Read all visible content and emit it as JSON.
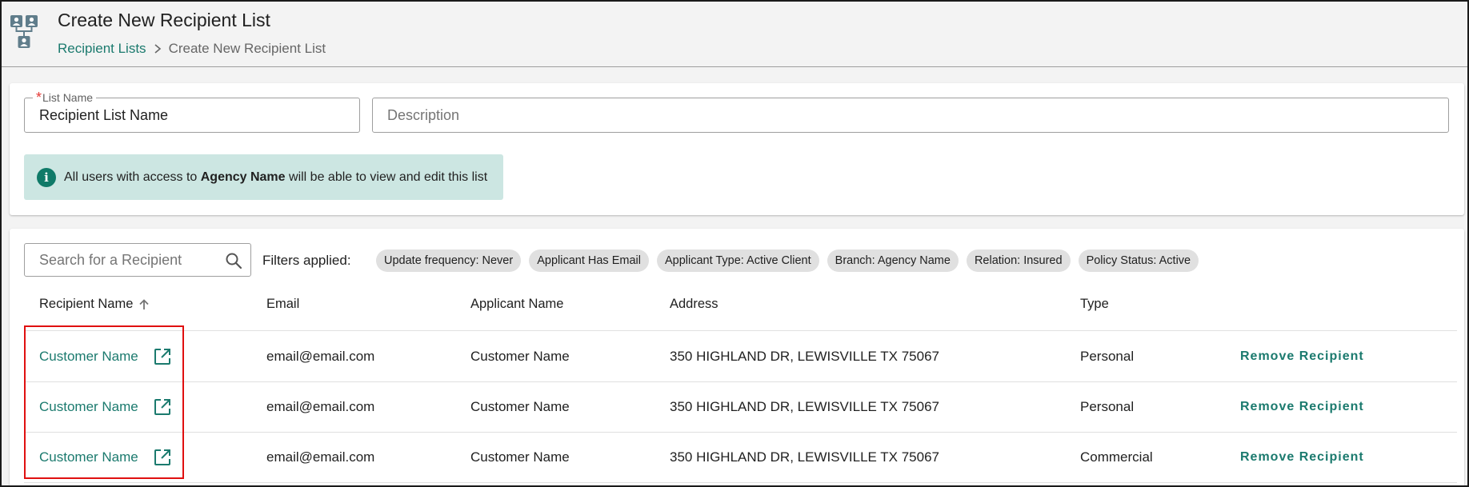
{
  "header": {
    "title": "Create New Recipient List",
    "breadcrumb": {
      "link": "Recipient Lists",
      "current": "Create New Recipient List"
    },
    "icon": "recipient-list-icon"
  },
  "form": {
    "list_name_label": "List Name",
    "list_name_value": "Recipient List Name",
    "description_placeholder": "Description",
    "info_prefix": "All users with access to ",
    "info_agency": "Agency Name",
    "info_suffix": " will be able to view and edit this list"
  },
  "recipients": {
    "search_placeholder": "Search for a Recipient",
    "filters_label": "Filters applied:",
    "filters": [
      "Update frequency: Never",
      "Applicant Has Email",
      "Applicant Type: Active Client",
      "Branch: Agency Name",
      "Relation: Insured",
      "Policy Status: Active"
    ],
    "columns": {
      "name": "Recipient Name",
      "email": "Email",
      "applicant": "Applicant Name",
      "address": "Address",
      "type": "Type"
    },
    "sort": "ascending",
    "rows": [
      {
        "name": "Customer Name",
        "email": "email@email.com",
        "applicant": "Customer Name",
        "address": "350 HIGHLAND DR, LEWISVILLE TX 75067",
        "type": "Personal",
        "action": "Remove Recipient"
      },
      {
        "name": "Customer Name",
        "email": "email@email.com",
        "applicant": "Customer Name",
        "address": "350 HIGHLAND DR, LEWISVILLE TX 75067",
        "type": "Personal",
        "action": "Remove Recipient"
      },
      {
        "name": "Customer Name",
        "email": "email@email.com",
        "applicant": "Customer Name",
        "address": "350 HIGHLAND DR, LEWISVILLE TX 75067",
        "type": "Commercial",
        "action": "Remove Recipient"
      }
    ]
  },
  "colors": {
    "accent": "#1b7a6e",
    "info_bg": "#cce6e2",
    "highlight": "#e01010",
    "required": "#e53935"
  }
}
